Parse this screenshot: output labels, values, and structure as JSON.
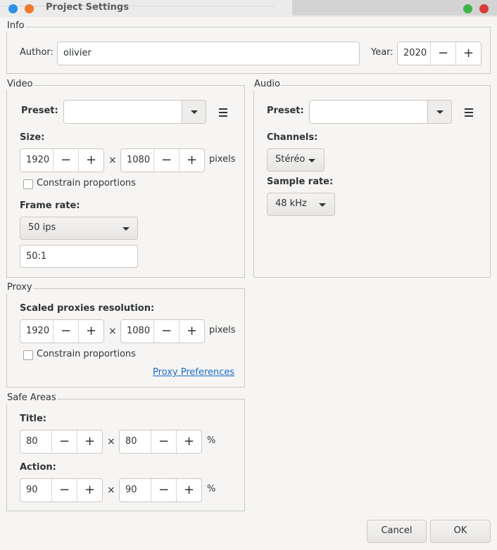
{
  "window": {
    "title": "Project Settings",
    "controls_colors": {
      "minimize": "#2d92e6",
      "maximize": "#f2782a",
      "zoom": "#3eb549",
      "close": "#d83b3b"
    }
  },
  "info": {
    "section_label": "Info",
    "author_label": "Author:",
    "author_value": "olivier",
    "year_label": "Year:",
    "year_value": "2020"
  },
  "video": {
    "section_label": "Video",
    "preset_label": "Preset:",
    "preset_value": "",
    "size_label": "Size:",
    "width": "1920",
    "height": "1080",
    "times": "×",
    "unit": "pixels",
    "constrain_label": "Constrain proportions",
    "frame_rate_label": "Frame rate:",
    "frame_rate_value": "50 ips",
    "frame_rate_ratio": "50:1"
  },
  "audio": {
    "section_label": "Audio",
    "preset_label": "Preset:",
    "preset_value": "",
    "channels_label": "Channels:",
    "channels_value": "Stéréo",
    "sample_rate_label": "Sample rate:",
    "sample_rate_value": "48 kHz"
  },
  "proxy": {
    "section_label": "Proxy",
    "resolution_label": "Scaled proxies resolution:",
    "width": "1920",
    "height": "1080",
    "times": "×",
    "unit": "pixels",
    "constrain_label": "Constrain proportions",
    "preferences_link": "Proxy Preferences"
  },
  "safe_areas": {
    "section_label": "Safe Areas",
    "title_label": "Title:",
    "title_w": "80",
    "title_h": "80",
    "action_label": "Action:",
    "action_w": "90",
    "action_h": "90",
    "times": "×",
    "unit": "%"
  },
  "spin": {
    "minus": "−",
    "plus": "+"
  },
  "footer": {
    "cancel_label": "Cancel",
    "ok_label": "OK"
  }
}
